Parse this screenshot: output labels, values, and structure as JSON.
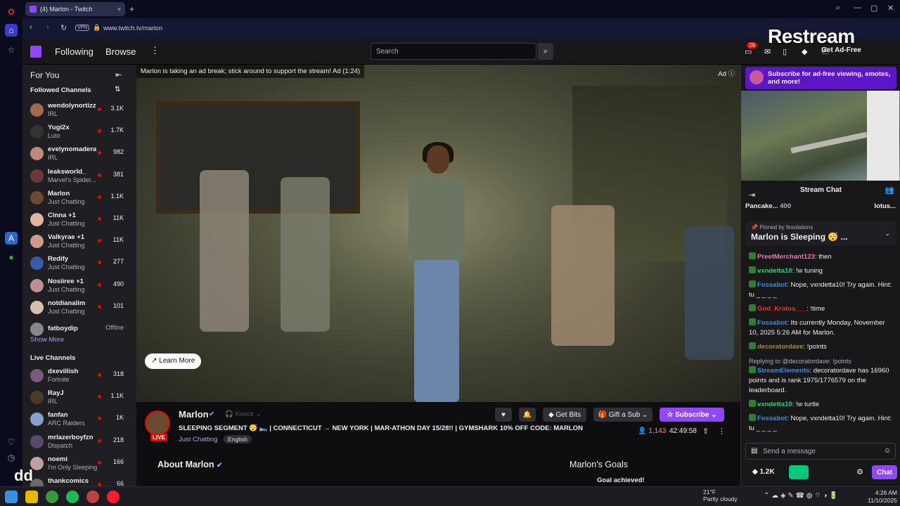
{
  "browser": {
    "tab_title": "(4) Marlon - Twitch",
    "url": "www.twitch.tv/marlon",
    "vpn_label": "VPN",
    "overlay_brand": "Restream"
  },
  "topnav": {
    "following": "Following",
    "browse": "Browse",
    "search_placeholder": "Search",
    "notif_count": "29",
    "get_ad_free": "Get Ad-Free"
  },
  "sidebar": {
    "for_you": "For You",
    "followed_header": "Followed Channels",
    "followed": [
      {
        "name": "wendolynortizz",
        "game": "IRL",
        "viewers": "3.1K",
        "color": "#a36a4f"
      },
      {
        "name": "Yugi2x",
        "game": "Luto",
        "viewers": "1.7K",
        "color": "#333333"
      },
      {
        "name": "evelynomadera",
        "game": "IRL",
        "viewers": "982",
        "color": "#c08a7a"
      },
      {
        "name": "leaksworld_",
        "game": "Marvel's Spider...",
        "viewers": "381",
        "color": "#6a3a3a"
      },
      {
        "name": "Marlon",
        "game": "Just Chatting",
        "viewers": "1.1K",
        "color": "#6b4a32"
      },
      {
        "name": "Cinna +1",
        "game": "Just Chatting",
        "viewers": "11K",
        "color": "#e0b4a0"
      },
      {
        "name": "Valkyrae +1",
        "game": "Just Chatting",
        "viewers": "11K",
        "color": "#d09a8a"
      },
      {
        "name": "Redify",
        "game": "Just Chatting",
        "viewers": "277",
        "color": "#3b5ba8"
      },
      {
        "name": "Nosiiree +1",
        "game": "Just Chatting",
        "viewers": "490",
        "color": "#c09090"
      },
      {
        "name": "notdianalim",
        "game": "Just Chatting",
        "viewers": "101",
        "color": "#d8c0b0"
      },
      {
        "name": "fatboydip",
        "game": "",
        "viewers": "Offline",
        "color": "#888888"
      }
    ],
    "show_more_1": "Show More",
    "live_header": "Live Channels",
    "live": [
      {
        "name": "dxevillish",
        "game": "Fortnite",
        "viewers": "318",
        "color": "#7a5a7a"
      },
      {
        "name": "RayJ",
        "game": "IRL",
        "viewers": "1.1K",
        "color": "#4a3a2a"
      },
      {
        "name": "fanfan",
        "game": "ARC Raiders",
        "viewers": "1K",
        "color": "#8aa0c8"
      },
      {
        "name": "mrlazerboyfzn",
        "game": "Dispatch",
        "viewers": "218",
        "color": "#5a4a6a"
      },
      {
        "name": "noemi",
        "game": "I'm Only Sleeping",
        "viewers": "166",
        "color": "#c0a0a0"
      },
      {
        "name": "thankcomics",
        "game": "",
        "viewers": "66",
        "color": "#6a6a6a"
      }
    ]
  },
  "video": {
    "ad_banner": "Marlon is taking an ad break; stick around to support the stream! Ad (1:24)",
    "ad_tag": "Ad",
    "learn_more": "Learn More"
  },
  "stream": {
    "streamer": "Marlon",
    "live": "LIVE",
    "knock": "Knock",
    "title": "SLEEPING SEGMENT 😴 🛌 | CONNECTICUT → NEW YORK | MAR-ATHON DAY 15/28!! | GYMSHARK 10% OFF CODE: MARLON",
    "category": "Just Chatting",
    "language": "English",
    "get_bits": "Get Bits",
    "gift_sub": "Gift a Sub",
    "subscribe": "Subscribe",
    "viewers": "1,143",
    "uptime": "42:49:58",
    "about": "About Marlon",
    "goals": "Marlon's Goals",
    "goal_achieved": "Goal achieved!"
  },
  "chat": {
    "promo": "Subscribe for ad-free viewing, emotes, and more!",
    "title": "Stream Chat",
    "leader_1": "Pancake...",
    "leader_1_count": "400",
    "leader_2": "lotus...",
    "pinned_by": "Pinned by",
    "pinned_by_user": "fesolations",
    "pinned_msg": "Marlon is Sleeping 😴 ...",
    "messages": [
      {
        "user": "PreetMerchant123",
        "color": "#ff6eb4",
        "text": ": then"
      },
      {
        "user": "vxndetta10",
        "color": "#00e676",
        "text": ": !w tuning"
      },
      {
        "user": "Fossabot",
        "color": "#1e90ff",
        "text": ": Nope, vxndetta10! Try again. Hint: tu _ _ _ _"
      },
      {
        "user": "God_Kratos___",
        "color": "#ff2a2a",
        "text": ": !time"
      },
      {
        "user": "Fossabot",
        "color": "#1e90ff",
        "text": ": Its currently Monday, November 10, 2025 5:26 AM for Marlon."
      },
      {
        "user": "decoratordave",
        "color": "#b8860b",
        "text": ": !points"
      },
      {
        "user": "StreamElements",
        "color": "#1e90ff",
        "text": ": decoratordave has 16960 points and is rank 1975/1776579 on the leaderboard.",
        "reply": "Replying to @decoratordave: !points"
      },
      {
        "user": "vxndetta10",
        "color": "#00e676",
        "text": ": !w turtle"
      },
      {
        "user": "Fossabot",
        "color": "#1e90ff",
        "text": ": Nope, vxndetta10! Try again. Hint: tu _ _ _ _"
      }
    ],
    "input_placeholder": "Send a message",
    "bits_count": "1.2K",
    "chat_button": "Chat"
  },
  "taskbar": {
    "temperature": "21°F",
    "weather": "Partly cloudy",
    "time": "4:26 AM",
    "date": "11/10/2025"
  },
  "overlay_text": "dd"
}
